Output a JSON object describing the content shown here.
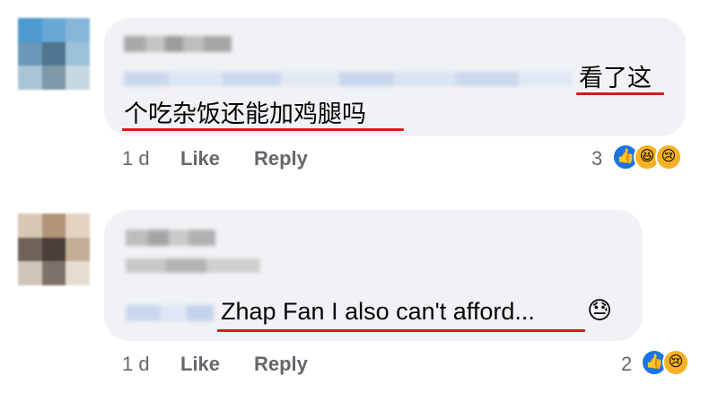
{
  "comments": [
    {
      "text_line1": "看了这",
      "text_line2": "个吃杂饭还能加鸡腿吗",
      "time": "1 d",
      "like_label": "Like",
      "reply_label": "Reply",
      "reaction_count": "3",
      "reactions": [
        "like",
        "haha",
        "sad"
      ],
      "avatar_colors": [
        "#4d9bd2",
        "#6aa9d6",
        "#86b7d8",
        "#6b97b8",
        "#4f7590",
        "#9cc0d8",
        "#a7c3d5",
        "#7f98a8",
        "#c6d8e2"
      ]
    },
    {
      "text": "Zhap Fan I also can't afford...",
      "emoji": "😓",
      "time": "1 d",
      "like_label": "Like",
      "reply_label": "Reply",
      "reaction_count": "2",
      "reactions": [
        "like",
        "sad"
      ],
      "avatar_colors": [
        "#d7c8b4",
        "#b49478",
        "#e2d2bf",
        "#6f6258",
        "#4b4039",
        "#c2ad95",
        "#cfc5bb",
        "#7d736b",
        "#e6ddd2"
      ]
    }
  ],
  "colors": {
    "bubble": "#f0f2f5",
    "meta_text": "#65676b",
    "annotation_underline": "#e0151b",
    "like_blue": "#1b74e4",
    "emoji_yellow": "#f7b125"
  }
}
